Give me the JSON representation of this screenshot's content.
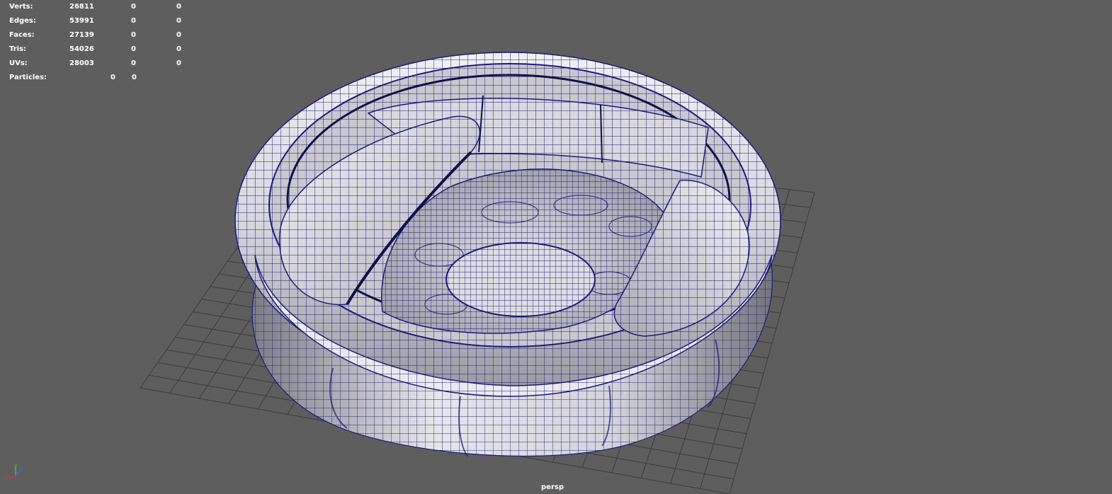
{
  "hud": {
    "rows": [
      {
        "label": "Verts:",
        "v1": "26811",
        "v2": "0",
        "v3": "0"
      },
      {
        "label": "Edges:",
        "v1": "53991",
        "v2": "0",
        "v3": "0"
      },
      {
        "label": "Faces:",
        "v1": "27139",
        "v2": "0",
        "v3": "0"
      },
      {
        "label": "Tris:",
        "v1": "54026",
        "v2": "0",
        "v3": "0"
      },
      {
        "label": "UVs:",
        "v1": "28003",
        "v2": "0",
        "v3": "0"
      }
    ],
    "particles": {
      "label": "Particles:",
      "v1": "0",
      "v2": "0"
    }
  },
  "camera": {
    "name": "persp"
  },
  "axis": {
    "x": "x",
    "y": "y",
    "z": "z"
  },
  "colors": {
    "background": "#5e5e5e",
    "grid": "#3a3a3a",
    "wireframe": "#1d1a78",
    "surface_light": "#e8e8ec",
    "surface_dark": "#6e6e76",
    "axis_x": "#d23c3c",
    "axis_y": "#3cc83c",
    "axis_z": "#3c6ee6"
  }
}
